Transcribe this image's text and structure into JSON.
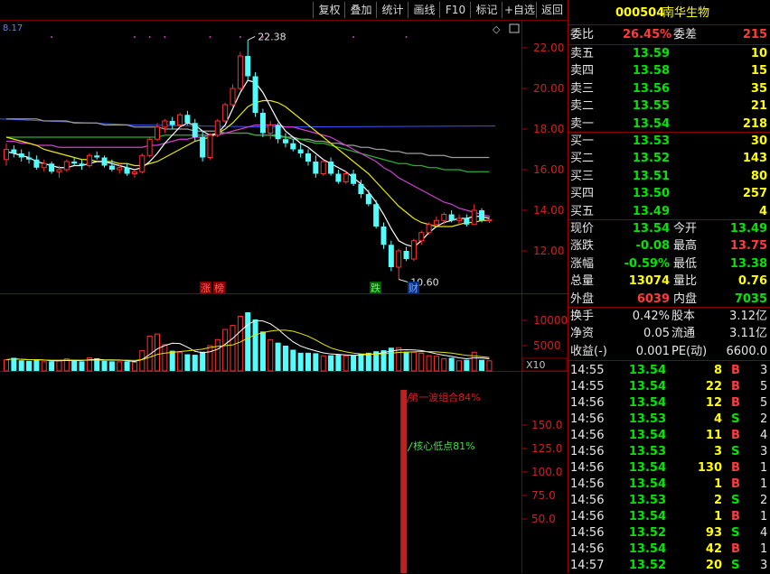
{
  "toolbar": {
    "buttons": [
      "复权",
      "叠加",
      "统计",
      "画线",
      "F10",
      "标记",
      "+自选",
      "返回"
    ]
  },
  "chart": {
    "top_left_value": "8.17",
    "price_axis": [
      "22.00",
      "20.00",
      "18.00",
      "16.00",
      "14.00",
      "12.00"
    ],
    "vol_axis": [
      "10000",
      "5000"
    ],
    "vol_unit": "X10",
    "ind_axis": [
      "150.0",
      "125.0",
      "100.0",
      "75.0",
      "50.0"
    ],
    "high_label": "22.38",
    "low_label": "10.60",
    "markers": {
      "zhang": "涨",
      "bang": "榜",
      "die": "跌",
      "cai": "财"
    },
    "ind_text1": "第一波组合84%",
    "ind_text2": "核心低点81%"
  },
  "stock": {
    "code": "000504",
    "name": "南华生物"
  },
  "weibi": {
    "label1": "委比",
    "val1": "26.45%",
    "label2": "委差",
    "val2": "215"
  },
  "asks": [
    {
      "label": "卖五",
      "price": "13.59",
      "vol": "10"
    },
    {
      "label": "卖四",
      "price": "13.58",
      "vol": "15"
    },
    {
      "label": "卖三",
      "price": "13.56",
      "vol": "35"
    },
    {
      "label": "卖二",
      "price": "13.55",
      "vol": "21"
    },
    {
      "label": "卖一",
      "price": "13.54",
      "vol": "218"
    }
  ],
  "bids": [
    {
      "label": "买一",
      "price": "13.53",
      "vol": "30"
    },
    {
      "label": "买二",
      "price": "13.52",
      "vol": "143"
    },
    {
      "label": "买三",
      "price": "13.51",
      "vol": "80"
    },
    {
      "label": "买四",
      "price": "13.50",
      "vol": "257"
    },
    {
      "label": "买五",
      "price": "13.49",
      "vol": "4"
    }
  ],
  "quote": [
    {
      "l1": "现价",
      "v1": "13.54",
      "c1": "green",
      "l2": "今开",
      "v2": "13.49",
      "c2": "green"
    },
    {
      "l1": "涨跌",
      "v1": "-0.08",
      "c1": "green",
      "l2": "最高",
      "v2": "13.75",
      "c2": "red"
    },
    {
      "l1": "涨幅",
      "v1": "-0.59%",
      "c1": "green",
      "l2": "最低",
      "v2": "13.38",
      "c2": "green"
    },
    {
      "l1": "总量",
      "v1": "13074",
      "c1": "yellow",
      "l2": "量比",
      "v2": "0.76",
      "c2": "yellow"
    },
    {
      "l1": "外盘",
      "v1": "6039",
      "c1": "red",
      "l2": "内盘",
      "v2": "7035",
      "c2": "green"
    }
  ],
  "finance": [
    {
      "l1": "换手",
      "v1": "0.42%",
      "l2": "股本",
      "v2": "3.12亿"
    },
    {
      "l1": "净资",
      "v1": "0.05",
      "l2": "流通",
      "v2": "3.11亿"
    },
    {
      "l1": "收益(-)",
      "v1": "0.001",
      "l2": "PE(动)",
      "v2": "6600.0"
    }
  ],
  "trades": [
    {
      "time": "14:55",
      "price": "13.54",
      "vol": "8",
      "side": "B",
      "n": "3"
    },
    {
      "time": "14:55",
      "price": "13.54",
      "vol": "22",
      "side": "B",
      "n": "5"
    },
    {
      "time": "14:56",
      "price": "13.54",
      "vol": "12",
      "side": "B",
      "n": "5"
    },
    {
      "time": "14:56",
      "price": "13.53",
      "vol": "4",
      "side": "S",
      "n": "2"
    },
    {
      "time": "14:56",
      "price": "13.54",
      "vol": "11",
      "side": "B",
      "n": "4"
    },
    {
      "time": "14:56",
      "price": "13.53",
      "vol": "3",
      "side": "S",
      "n": "3"
    },
    {
      "time": "14:56",
      "price": "13.54",
      "vol": "130",
      "side": "B",
      "n": "1"
    },
    {
      "time": "14:56",
      "price": "13.54",
      "vol": "1",
      "side": "B",
      "n": "1"
    },
    {
      "time": "14:56",
      "price": "13.53",
      "vol": "2",
      "side": "S",
      "n": "2"
    },
    {
      "time": "14:56",
      "price": "13.54",
      "vol": "1",
      "side": "B",
      "n": "1"
    },
    {
      "time": "14:56",
      "price": "13.52",
      "vol": "93",
      "side": "S",
      "n": "4"
    },
    {
      "time": "14:56",
      "price": "13.54",
      "vol": "42",
      "side": "B",
      "n": "1"
    },
    {
      "time": "14:57",
      "price": "13.52",
      "vol": "20",
      "side": "S",
      "n": "3"
    }
  ],
  "chart_data": {
    "type": "candlestick",
    "ylim": [
      10.0,
      23.0
    ],
    "candles": [
      [
        16.5,
        17.3,
        16.2,
        17.0
      ],
      [
        17.0,
        17.2,
        16.6,
        16.8
      ],
      [
        16.8,
        17.0,
        16.4,
        16.6
      ],
      [
        16.6,
        16.9,
        16.3,
        16.5
      ],
      [
        16.5,
        16.7,
        16.0,
        16.1
      ],
      [
        16.1,
        16.5,
        15.9,
        16.3
      ],
      [
        16.3,
        16.4,
        15.8,
        15.9
      ],
      [
        15.9,
        16.2,
        15.6,
        16.0
      ],
      [
        16.0,
        16.5,
        15.9,
        16.4
      ],
      [
        16.4,
        16.6,
        16.2,
        16.3
      ],
      [
        16.3,
        16.5,
        16.0,
        16.2
      ],
      [
        16.2,
        16.8,
        16.1,
        16.7
      ],
      [
        16.7,
        16.9,
        16.5,
        16.6
      ],
      [
        16.6,
        16.7,
        16.1,
        16.2
      ],
      [
        16.2,
        16.5,
        15.9,
        16.0
      ],
      [
        16.0,
        16.3,
        15.8,
        16.1
      ],
      [
        16.1,
        16.3,
        15.7,
        15.8
      ],
      [
        15.8,
        16.0,
        15.6,
        15.9
      ],
      [
        15.9,
        16.8,
        15.8,
        16.7
      ],
      [
        16.7,
        17.6,
        16.6,
        17.5
      ],
      [
        17.5,
        18.3,
        17.4,
        18.1
      ],
      [
        18.1,
        18.5,
        17.8,
        18.4
      ],
      [
        18.4,
        18.6,
        18.0,
        18.2
      ],
      [
        18.2,
        18.8,
        18.1,
        18.7
      ],
      [
        18.7,
        18.9,
        18.2,
        18.3
      ],
      [
        18.3,
        18.5,
        17.4,
        17.6
      ],
      [
        17.6,
        17.9,
        16.4,
        16.6
      ],
      [
        16.6,
        17.8,
        16.5,
        17.7
      ],
      [
        17.7,
        18.5,
        17.6,
        18.4
      ],
      [
        18.4,
        19.3,
        18.3,
        19.2
      ],
      [
        19.2,
        20.2,
        19.1,
        20.0
      ],
      [
        20.0,
        21.8,
        19.9,
        21.6
      ],
      [
        21.6,
        22.38,
        20.4,
        20.6
      ],
      [
        20.6,
        20.8,
        18.6,
        18.8
      ],
      [
        18.8,
        19.0,
        17.6,
        17.8
      ],
      [
        17.8,
        18.4,
        17.5,
        18.2
      ],
      [
        18.2,
        18.3,
        17.3,
        17.5
      ],
      [
        17.5,
        17.8,
        17.1,
        17.3
      ],
      [
        17.3,
        17.5,
        16.9,
        17.0
      ],
      [
        17.0,
        17.3,
        16.6,
        16.8
      ],
      [
        16.8,
        17.0,
        16.2,
        16.4
      ],
      [
        16.4,
        16.7,
        15.6,
        15.8
      ],
      [
        15.8,
        16.5,
        15.7,
        16.4
      ],
      [
        16.4,
        16.6,
        15.7,
        15.8
      ],
      [
        15.8,
        16.0,
        15.3,
        15.4
      ],
      [
        15.4,
        15.9,
        15.3,
        15.8
      ],
      [
        15.8,
        16.0,
        15.2,
        15.3
      ],
      [
        15.3,
        15.5,
        14.6,
        14.8
      ],
      [
        14.8,
        15.0,
        14.2,
        14.3
      ],
      [
        14.3,
        14.5,
        13.1,
        13.2
      ],
      [
        13.2,
        13.4,
        12.1,
        12.3
      ],
      [
        12.3,
        12.5,
        11.0,
        11.2
      ],
      [
        11.2,
        12.1,
        10.6,
        12.0
      ],
      [
        12.0,
        12.2,
        11.5,
        11.6
      ],
      [
        11.6,
        12.6,
        11.5,
        12.5
      ],
      [
        12.5,
        13.0,
        12.3,
        12.9
      ],
      [
        12.9,
        13.4,
        12.8,
        13.3
      ],
      [
        13.3,
        13.7,
        13.2,
        13.5
      ],
      [
        13.5,
        13.9,
        13.3,
        13.8
      ],
      [
        13.8,
        14.0,
        13.4,
        13.5
      ],
      [
        13.5,
        13.8,
        13.3,
        13.6
      ],
      [
        13.6,
        13.8,
        13.2,
        13.3
      ],
      [
        13.3,
        14.3,
        13.3,
        14.0
      ],
      [
        14.0,
        14.1,
        13.4,
        13.5
      ],
      [
        13.49,
        13.75,
        13.38,
        13.54
      ]
    ],
    "volumes": [
      2200,
      2600,
      2100,
      2000,
      2300,
      1800,
      1900,
      2000,
      2400,
      2100,
      1900,
      2600,
      2500,
      2000,
      1900,
      1800,
      1900,
      1700,
      4000,
      6900,
      7300,
      5200,
      4000,
      3700,
      3300,
      3200,
      3800,
      5000,
      6200,
      8200,
      9000,
      10800,
      11600,
      10200,
      7800,
      6200,
      5600,
      5000,
      4200,
      3600,
      3600,
      3500,
      3000,
      3100,
      3200,
      3000,
      3100,
      3400,
      3600,
      3900,
      4100,
      4600,
      4600,
      3800,
      3700,
      3500,
      3000,
      2900,
      2400,
      2600,
      2000,
      2200,
      3700,
      2200,
      2000
    ],
    "ma_short": [
      16.9,
      16.8,
      16.7,
      16.6,
      16.4,
      16.3,
      16.2,
      16.1,
      16.1,
      16.2,
      16.2,
      16.3,
      16.4,
      16.4,
      16.3,
      16.2,
      16.1,
      16.0,
      16.1,
      16.4,
      16.8,
      17.3,
      17.7,
      18.1,
      18.3,
      18.2,
      17.9,
      17.7,
      17.8,
      18.2,
      19.0,
      19.8,
      20.4,
      20.3,
      19.8,
      19.1,
      18.4,
      17.9,
      17.6,
      17.3,
      17.1,
      16.8,
      16.5,
      16.3,
      16.1,
      15.9,
      15.6,
      15.3,
      14.9,
      14.4,
      13.8,
      13.1,
      12.5,
      12.3,
      12.2,
      12.5,
      12.9,
      13.2,
      13.4,
      13.5,
      13.6,
      13.6,
      13.7,
      13.7,
      13.6
    ],
    "ma_mid": [
      17.6,
      17.5,
      17.4,
      17.3,
      17.2,
      17.0,
      16.9,
      16.8,
      16.7,
      16.6,
      16.5,
      16.5,
      16.4,
      16.4,
      16.4,
      16.3,
      16.3,
      16.2,
      16.2,
      16.3,
      16.4,
      16.6,
      16.8,
      17.0,
      17.2,
      17.4,
      17.5,
      17.6,
      17.8,
      18.0,
      18.3,
      18.7,
      19.1,
      19.3,
      19.4,
      19.4,
      19.3,
      19.1,
      18.8,
      18.5,
      18.2,
      17.9,
      17.6,
      17.3,
      17.0,
      16.7,
      16.4,
      16.1,
      15.8,
      15.4,
      15.0,
      14.6,
      14.2,
      13.9,
      13.6,
      13.4,
      13.3,
      13.2,
      13.2,
      13.2,
      13.3,
      13.4,
      13.4,
      13.5,
      13.5
    ],
    "ma_60": [
      17.4,
      17.4,
      17.3,
      17.3,
      17.2,
      17.2,
      17.2,
      17.1,
      17.1,
      17.1,
      17.1,
      17.1,
      17.1,
      17.1,
      17.1,
      17.1,
      17.1,
      17.1,
      17.1,
      17.2,
      17.2,
      17.3,
      17.4,
      17.5,
      17.5,
      17.6,
      17.6,
      17.7,
      17.7,
      17.8,
      17.9,
      18.0,
      18.1,
      18.2,
      18.2,
      18.2,
      18.2,
      18.1,
      18.1,
      18.0,
      17.9,
      17.8,
      17.7,
      17.6,
      17.4,
      17.2,
      17.0,
      16.8,
      16.6,
      16.4,
      16.1,
      15.9,
      15.6,
      15.4,
      15.2,
      15.0,
      14.8,
      14.6,
      14.4,
      14.3,
      14.1,
      14.0,
      13.9,
      13.8,
      13.7
    ],
    "ma_120": [
      17.6,
      17.6,
      17.6,
      17.6,
      17.6,
      17.6,
      17.6,
      17.6,
      17.6,
      17.6,
      17.6,
      17.6,
      17.6,
      17.6,
      17.6,
      17.6,
      17.6,
      17.6,
      17.6,
      17.6,
      17.6,
      17.7,
      17.7,
      17.7,
      17.7,
      17.7,
      17.7,
      17.7,
      17.8,
      17.8,
      17.8,
      17.8,
      17.8,
      17.7,
      17.7,
      17.7,
      17.6,
      17.6,
      17.5,
      17.5,
      17.4,
      17.3,
      17.3,
      17.2,
      17.1,
      17.0,
      16.9,
      16.8,
      16.7,
      16.6,
      16.5,
      16.4,
      16.3,
      16.3,
      16.2,
      16.2,
      16.1,
      16.1,
      16.0,
      16.0,
      16.0,
      15.9,
      15.9,
      15.9,
      15.9
    ],
    "ma_250": [
      18.5,
      18.5,
      18.5,
      18.5,
      18.5,
      18.4,
      18.4,
      18.4,
      18.4,
      18.3,
      18.3,
      18.3,
      18.3,
      18.2,
      18.2,
      18.2,
      18.2,
      18.1,
      18.1,
      18.1,
      18.1,
      18.0,
      18.0,
      18.0,
      18.0,
      17.9,
      17.9,
      17.9,
      17.9,
      17.8,
      17.8,
      17.8,
      17.8,
      17.7,
      17.7,
      17.7,
      17.7,
      17.6,
      17.6,
      17.5,
      17.5,
      17.4,
      17.4,
      17.3,
      17.3,
      17.2,
      17.2,
      17.1,
      17.1,
      17.0,
      17.0,
      16.9,
      16.9,
      16.8,
      16.8,
      16.8,
      16.7,
      16.7,
      16.7,
      16.6,
      16.6,
      16.6,
      16.6,
      16.6,
      16.6
    ],
    "ma_flat": 18.2,
    "indicator_spike": {
      "index": 52,
      "value": 200
    }
  }
}
